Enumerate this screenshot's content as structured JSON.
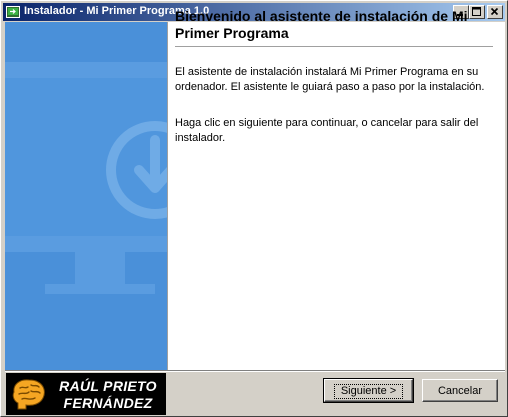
{
  "window": {
    "title": "Instalador - Mi Primer Programa 1.0",
    "icons": {
      "app": "installer-app-icon",
      "minimize": "minimize-icon",
      "maximize": "maximize-icon",
      "close": "close-icon"
    }
  },
  "side_panel": {
    "icon": "monitor-download-icon",
    "color": "#4a90d9"
  },
  "main": {
    "title": "Bienvenido al asistente de instalación de Mi Primer Programa",
    "paragraph1": "El asistente de instalación instalará Mi Primer Programa en su ordenador. El asistente le guiará paso a paso por la instalación.",
    "paragraph2": "Haga clic en siguiente para continuar, o cancelar para salir del instalador."
  },
  "brand": {
    "line1": "RAÚL PRIETO",
    "line2": "FERNÁNDEZ",
    "icon": "brain-logo-icon",
    "accent": "#f5a623"
  },
  "buttons": {
    "next": "Siguiente >",
    "cancel": "Cancelar"
  }
}
